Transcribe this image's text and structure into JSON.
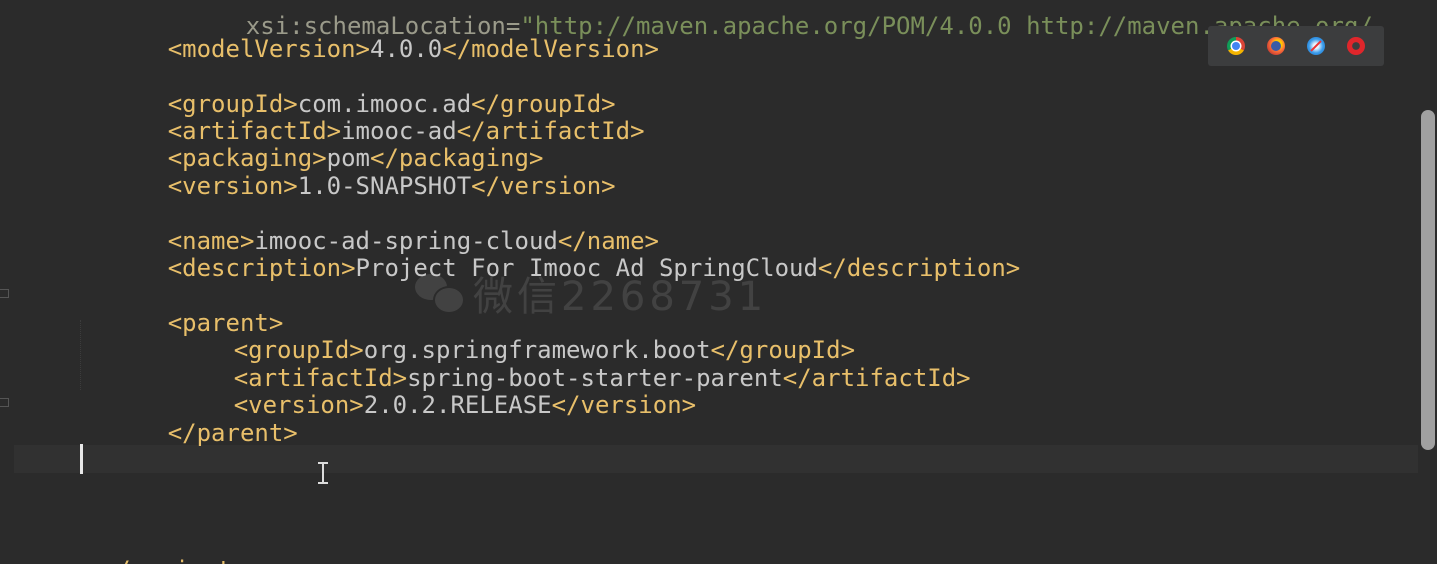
{
  "editor": {
    "top_cut_line": {
      "attr": "xsi:schemaLocation=",
      "value": "\"http://maven.apache.org/POM/4.0.0 http://maven.apache.org/"
    },
    "lines": [
      {
        "open": "<modelVersion>",
        "text": "4.0.0",
        "close": "</modelVersion>"
      },
      {
        "open": "<groupId>",
        "text": "com.imooc.ad",
        "close": "</groupId>"
      },
      {
        "open": "<artifactId>",
        "text": "imooc-ad",
        "close": "</artifactId>"
      },
      {
        "open": "<packaging>",
        "text": "pom",
        "close": "</packaging>"
      },
      {
        "open": "<version>",
        "text": "1.0-SNAPSHOT",
        "close": "</version>"
      },
      {
        "open": "<name>",
        "text": "imooc-ad-spring-cloud",
        "close": "</name>"
      },
      {
        "open": "<description>",
        "text": "Project For Imooc Ad SpringCloud",
        "close": "</description>"
      },
      {
        "open": "<parent>"
      },
      {
        "open": "<groupId>",
        "text": "org.springframework.boot",
        "close": "</groupId>"
      },
      {
        "open": "<artifactId>",
        "text": "spring-boot-starter-parent",
        "close": "</artifactId>"
      },
      {
        "open": "<version>",
        "text": "2.0.2.RELEASE",
        "close": "</version>"
      },
      {
        "open": "</parent>"
      },
      {
        "open": "</project>"
      }
    ]
  },
  "watermark": {
    "text": "微信2268731"
  },
  "browser_bar": {
    "icons": [
      "chrome-icon",
      "firefox-icon",
      "safari-icon",
      "opera-icon"
    ]
  },
  "colors": {
    "background": "#2b2b2b",
    "tag": "#e8bf6a",
    "text": "#c8c8c8",
    "current_line": "#313131"
  }
}
